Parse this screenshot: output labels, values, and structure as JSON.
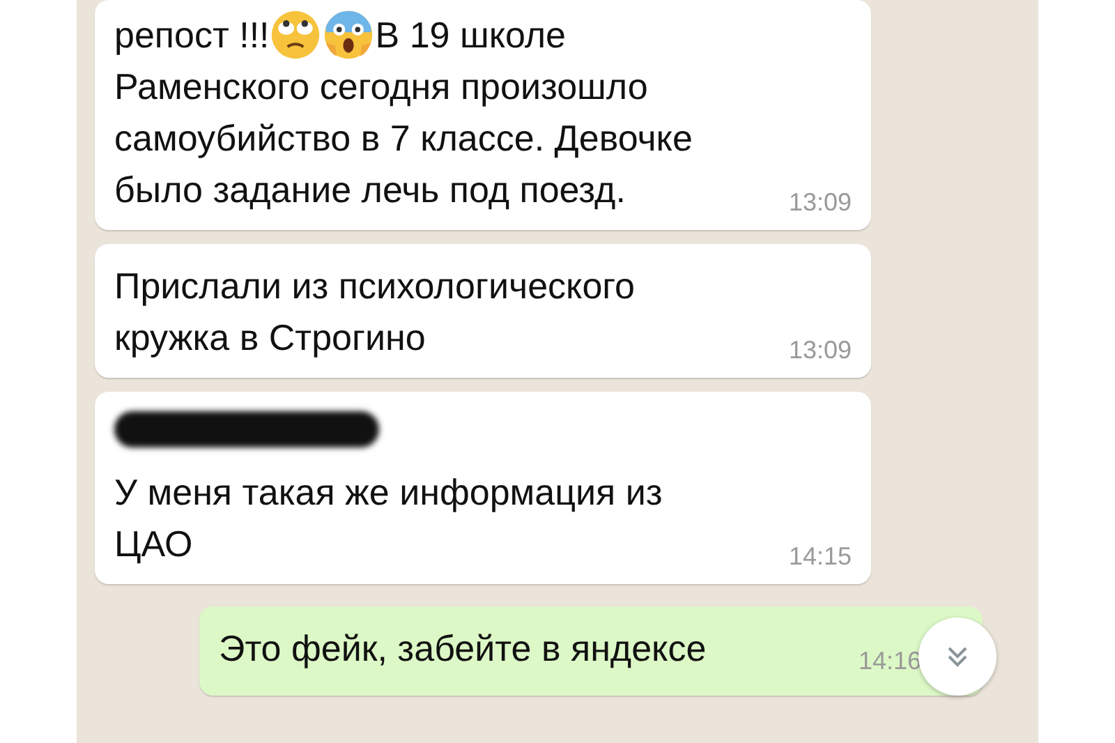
{
  "messages": [
    {
      "kind": "incoming",
      "lead": "репост !!!",
      "lead_after_emojis": "В 19 школе",
      "text": "Раменского сегодня произошло\nсамоубийство в 7 классе. Девочке\nбыло задание лечь под поезд.",
      "time": "13:09"
    },
    {
      "kind": "incoming",
      "text": "Прислали из психологического\nкружка в Строгино",
      "time": "13:09"
    },
    {
      "kind": "incoming",
      "sender_hidden": true,
      "text": "У меня такая же информация из\nЦАО",
      "time": "14:15"
    },
    {
      "kind": "outgoing",
      "text": "Это фейк, забейте в яндексе",
      "time": "14:16"
    }
  ]
}
